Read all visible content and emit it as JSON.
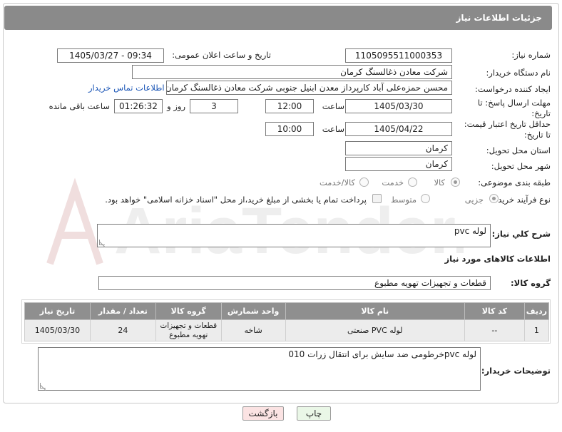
{
  "header": {
    "title": "جزئیات اطلاعات نیاز"
  },
  "fields": {
    "need_number_label": "شماره نیاز:",
    "need_number": "1105095511000353",
    "announce_label": "تاریخ و ساعت اعلان عمومی:",
    "announce_value": "1405/03/27 - 09:34",
    "buyer_org_label": "نام دستگاه خریدار:",
    "buyer_org": "شرکت معادن ذغالسنگ کرمان",
    "requester_label": "ایجاد کننده درخواست:",
    "requester": "محسن حمزه‌علی آباد کارپرداز معدن ابنیل جنوبی شرکت معادن ذغالسنگ کرمان",
    "contact_link": "اطلاعات تماس خریدار",
    "deadline_label_1": "مهلت ارسال پاسخ: تا",
    "deadline_label_2": "تاریخ:",
    "deadline_date": "1405/03/30",
    "time_label": "ساعت",
    "deadline_time": "12:00",
    "days_value": "3",
    "days_label": "روز و",
    "remaining_time": "01:26:32",
    "remaining_label": "ساعت باقی مانده",
    "validity_label_1": "حداقل تاریخ اعتبار قیمت:",
    "validity_label_2": "تا تاریخ:",
    "validity_date": "1405/04/22",
    "validity_time": "10:00",
    "province_label": "استان محل تحویل:",
    "province": "کرمان",
    "city_label": "شهر محل تحویل:",
    "city": "کرمان",
    "category_label": "طبقه بندی موضوعی:",
    "category_options": [
      "کالا",
      "خدمت",
      "کالا/خدمت"
    ],
    "process_label": "نوع فرآیند خرید :",
    "process_options": [
      "جزیی",
      "متوسط"
    ],
    "payment_note": "پرداخت تمام یا بخشی از مبلغ خرید،از محل \"اسناد خزانه اسلامی\" خواهد بود."
  },
  "summary": {
    "label": "شرح کلي نياز:",
    "value": "لوله  pvc"
  },
  "goods_section_title": "اطلاعات کالاهای مورد نیاز",
  "goods_group": {
    "label": "گروه کالا:",
    "value": "قطعات و تجهیزات تهویه مطبوع"
  },
  "table": {
    "headers": [
      "ردیف",
      "کد کالا",
      "نام کالا",
      "واحد شمارش",
      "گروه کالا",
      "تعداد / مقدار",
      "تاریخ نیاز"
    ],
    "rows": [
      [
        "1",
        "--",
        "لوله PVC صنعتی",
        "شاخه",
        "قطعات و تجهیزات تهویه مطبوع",
        "24",
        "1405/03/30"
      ]
    ]
  },
  "buyer_notes": {
    "label": "توضیحات خریدار:",
    "value": "لوله pvcخرطومی ضد سایش برای انتقال زرات 010"
  },
  "buttons": {
    "print": "چاپ",
    "back": "بازگشت"
  },
  "watermark": {
    "text": "AriaTender.neT"
  }
}
